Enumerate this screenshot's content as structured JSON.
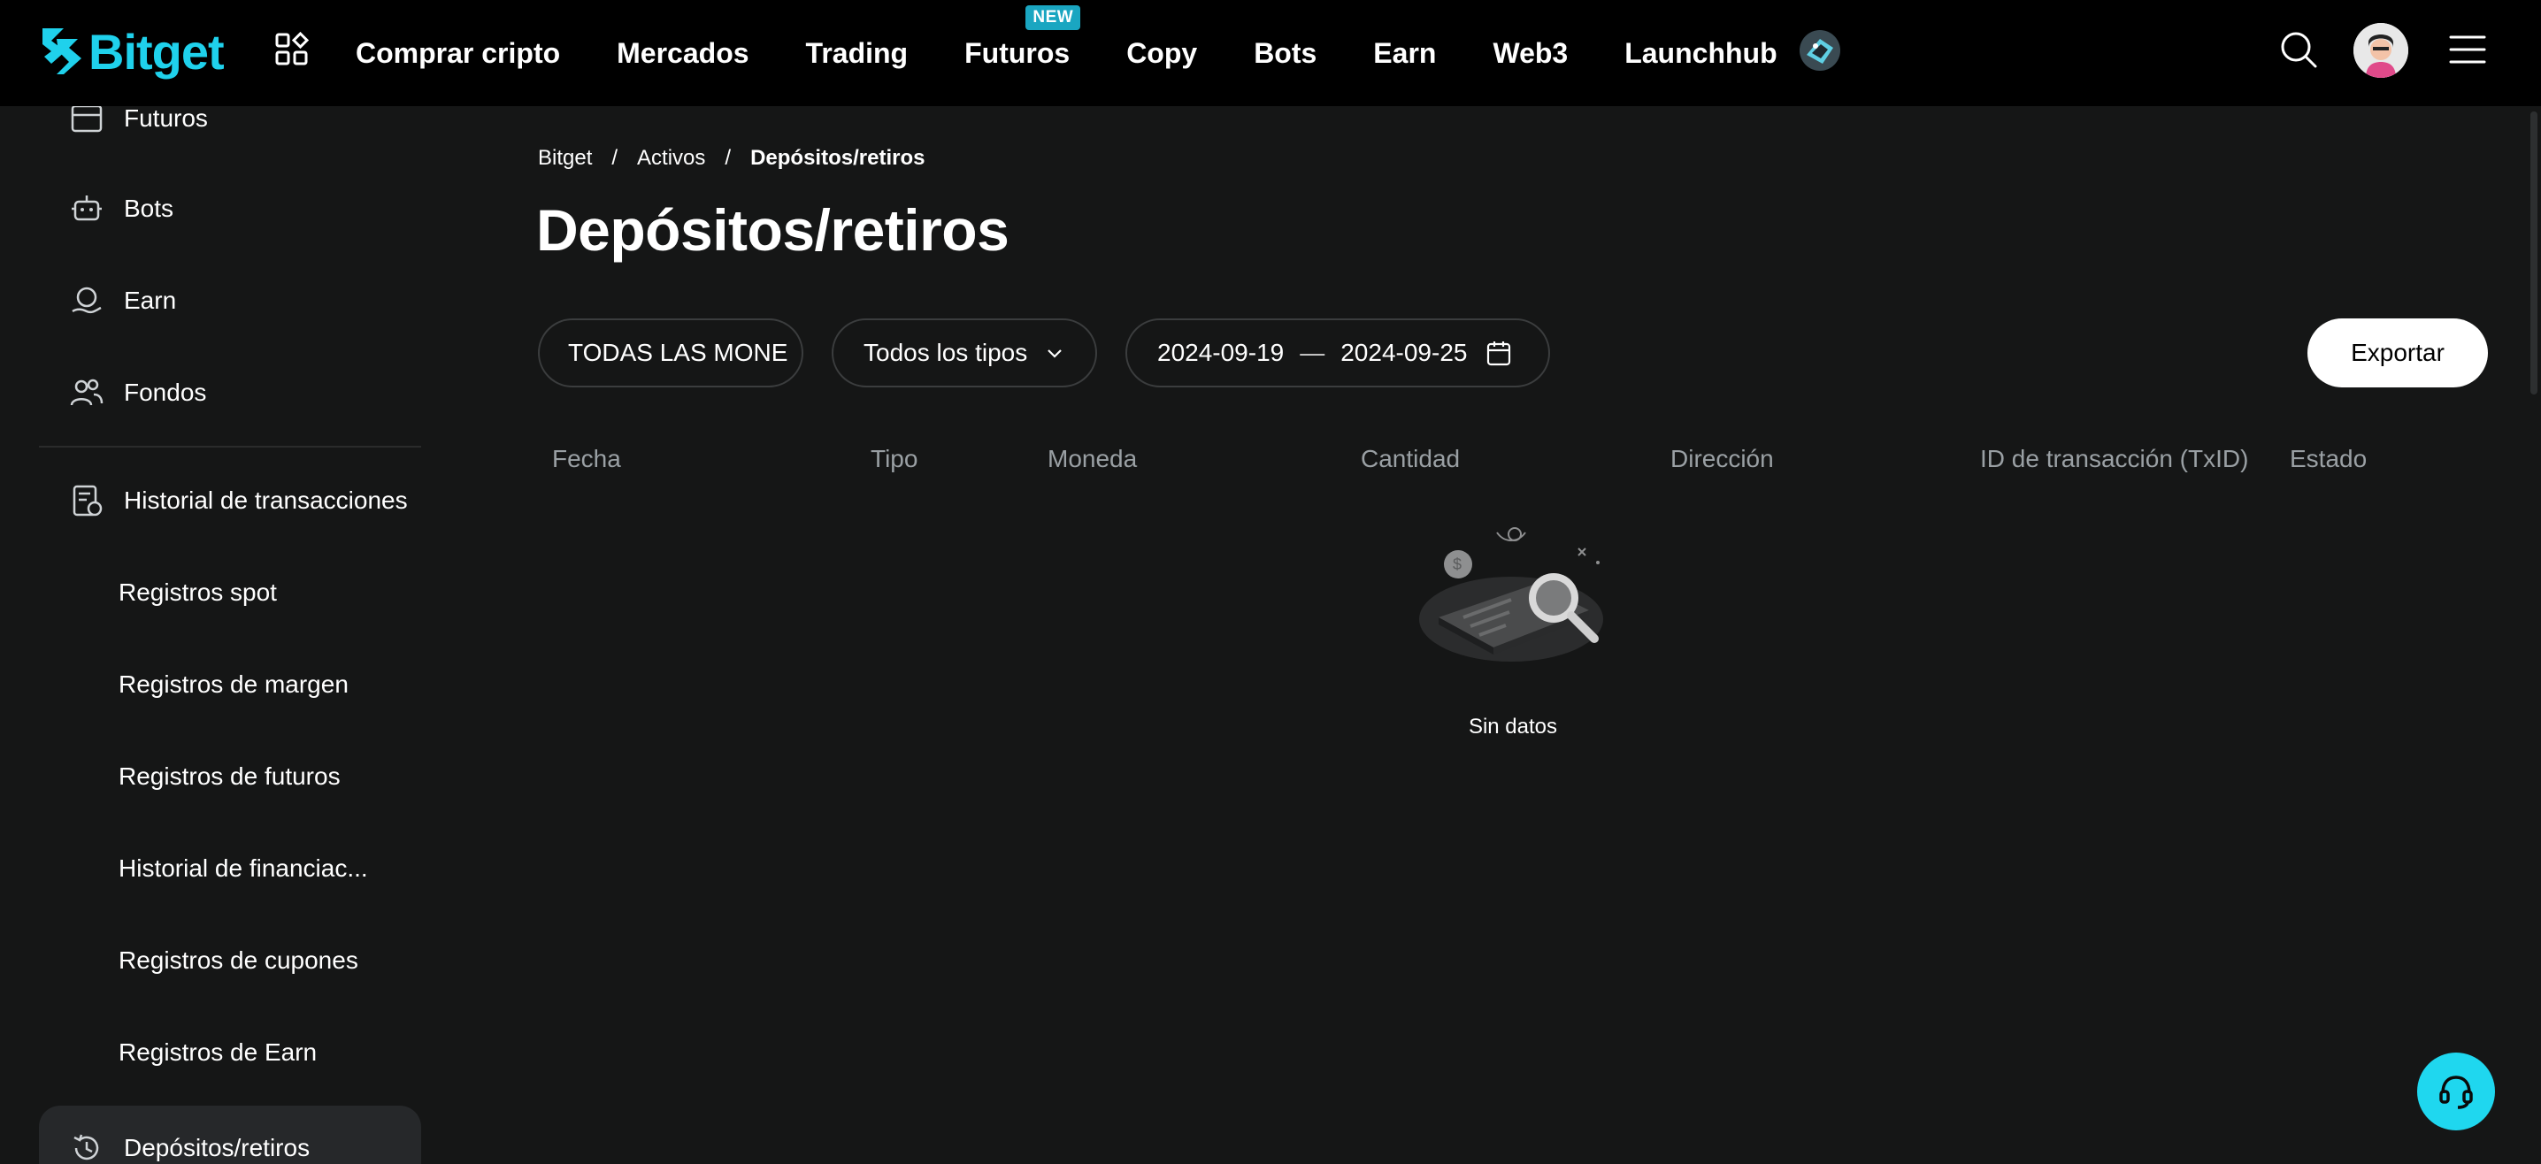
{
  "brand": {
    "name": "Bitget",
    "accent": "#1fd1ec"
  },
  "nav": {
    "items": [
      {
        "label": "Comprar cripto"
      },
      {
        "label": "Mercados"
      },
      {
        "label": "Trading"
      },
      {
        "label": "Futuros",
        "badge": "NEW"
      },
      {
        "label": "Copy"
      },
      {
        "label": "Bots"
      },
      {
        "label": "Earn"
      },
      {
        "label": "Web3"
      },
      {
        "label": "Launchhub"
      }
    ],
    "icons": [
      "apps-icon",
      "launchhub-special-icon",
      "search-icon",
      "avatar",
      "menu-icon"
    ]
  },
  "sidebar": {
    "items": [
      {
        "label": "Futuros",
        "icon": "futures-icon"
      },
      {
        "label": "Bots",
        "icon": "robot-icon"
      },
      {
        "label": "Earn",
        "icon": "earn-icon"
      },
      {
        "label": "Fondos",
        "icon": "users-icon"
      },
      {
        "label": "Historial de transacciones",
        "icon": "history-doc-icon"
      }
    ],
    "subitems": [
      {
        "label": "Registros spot"
      },
      {
        "label": "Registros de margen"
      },
      {
        "label": "Registros de futuros"
      },
      {
        "label": "Historial de financiac..."
      },
      {
        "label": "Registros de cupones"
      },
      {
        "label": "Registros de Earn"
      }
    ],
    "active": {
      "label": "Depósitos/retiros",
      "icon": "history-icon"
    }
  },
  "breadcrumb": {
    "items": [
      "Bitget",
      "Activos",
      "Depósitos/retiros"
    ],
    "separator": "/"
  },
  "page": {
    "title": "Depósitos/retiros"
  },
  "filters": {
    "coin": "TODAS LAS MONE",
    "type": "Todos los tipos",
    "date_from": "2024-09-19",
    "date_sep": "—",
    "date_to": "2024-09-25"
  },
  "export_label": "Exportar",
  "table": {
    "headers": [
      "Fecha",
      "Tipo",
      "Moneda",
      "Cantidad",
      "Dirección",
      "ID de transacción (TxID)",
      "Estado"
    ]
  },
  "empty_state": {
    "text": "Sin datos"
  },
  "colors": {
    "background": "#151616",
    "topbar": "#000000",
    "support": "#1fd7ef"
  }
}
